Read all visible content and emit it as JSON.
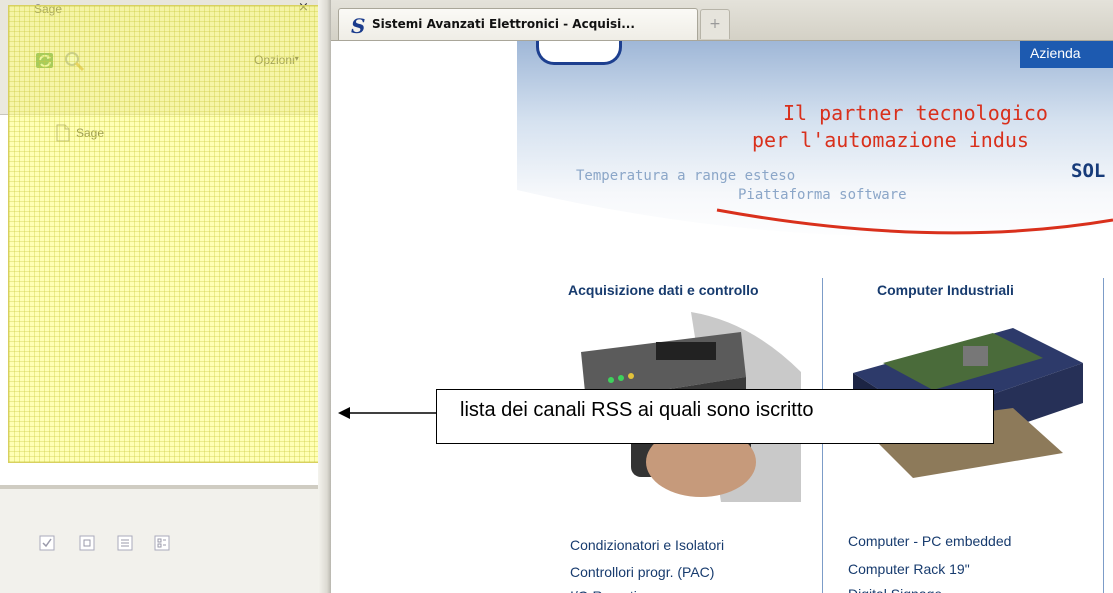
{
  "sidebar": {
    "title": "Sage",
    "close": "×",
    "options_label": "Opzioni",
    "feeds": [
      {
        "label": "Sage"
      }
    ],
    "icons": [
      "refresh-icon",
      "search-icon",
      "check-icon",
      "feed-icon",
      "list-icon",
      "detail-icon"
    ]
  },
  "browser": {
    "tab_favicon": "S",
    "tab_title": "Sistemi Avanzati Elettronici - Acquisi...",
    "new_tab": "+"
  },
  "page": {
    "azienda": "Azienda",
    "slogan_line1": "Il partner tecnologico",
    "slogan_line2": "per l'automazione indus",
    "brand_fragment": "SOL",
    "tagline1": "Temperatura a range esteso",
    "tagline2": "Piattaforma software",
    "columns": [
      {
        "heading": "Acquisizione dati e controllo",
        "links": [
          "Condizionatori e Isolatori",
          "Controllori progr. (PAC)",
          "I/O Remoti"
        ]
      },
      {
        "heading": "Computer Industriali",
        "links": [
          "Computer - PC embedded",
          "Computer Rack 19\"",
          "Digital Signage"
        ]
      }
    ],
    "colors": {
      "link": "#173b6e",
      "slogan": "#d9301c",
      "accent": "#1d5ab0"
    }
  },
  "annotation": {
    "text": "lista dei canali RSS ai quali sono iscritto",
    "highlight_color": "#ffff78"
  }
}
